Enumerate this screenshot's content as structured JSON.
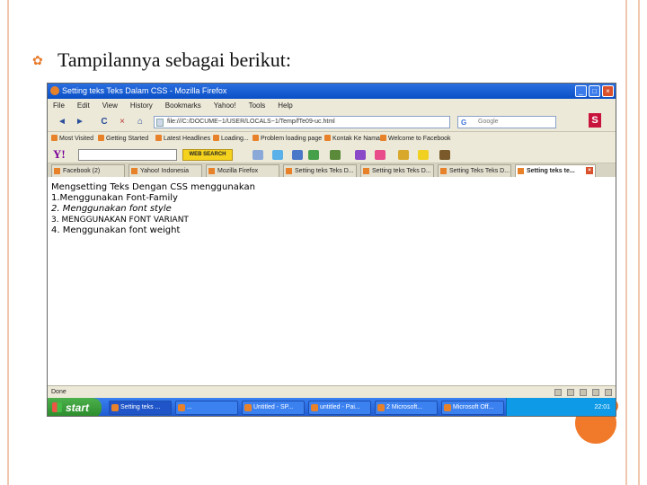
{
  "slide": {
    "bullet_icon": "orange-bullet",
    "text": "Tampilannya sebagai berikut:"
  },
  "window": {
    "title": "Setting teks Teks Dalam CSS - Mozilla Firefox",
    "buttons": {
      "minimize": "_",
      "maximize": "□",
      "close": "×"
    }
  },
  "menu": [
    "File",
    "Edit",
    "View",
    "History",
    "Bookmarks",
    "Yahoo!",
    "Tools",
    "Help"
  ],
  "nav": {
    "back": "◄",
    "forward": "►",
    "reload": "C",
    "stop": "×",
    "home": "⌂",
    "url": "file:///C:/DOCUME~1/USER/LOCALS~1/Temp/fTe09-uc.html",
    "search_placeholder": "Google"
  },
  "bookmarks": [
    "Most Visited",
    "Getting Started",
    "Latest Headlines",
    "Loading...",
    "Problem loading page",
    "Kontak Ke Nama",
    "Welcome to Facebook"
  ],
  "yahoo_toolbar": {
    "logo": "Y!",
    "search_value": "",
    "web_search_label": "WEB SEARCH"
  },
  "tabs": [
    {
      "label": "Facebook (2)"
    },
    {
      "label": "Yahoo! Indonesia"
    },
    {
      "label": "Mozilla Firefox"
    },
    {
      "label": "Setting teks Teks D..."
    },
    {
      "label": "Setting teks Teks D..."
    },
    {
      "label": "Setting Teks Teks D..."
    },
    {
      "label": "Setting teks te..."
    }
  ],
  "content": {
    "lines": [
      "Mengsetting Teks Dengan CSS menggunakan",
      "1.Menggunakan Font-Family",
      "2. Menggunakan font style",
      "3. MENGGUNAKAN FONT VARIANT",
      "4. Menggunakan font weight"
    ]
  },
  "status": {
    "text": "Done"
  },
  "taskbar": {
    "start_label": "start",
    "tasks": [
      "Setting teks ...",
      "...",
      "Untitled - SP...",
      "untitled - Pai...",
      "2 Microsoft...",
      "Microsoft Off..."
    ],
    "clock": "22:01"
  }
}
